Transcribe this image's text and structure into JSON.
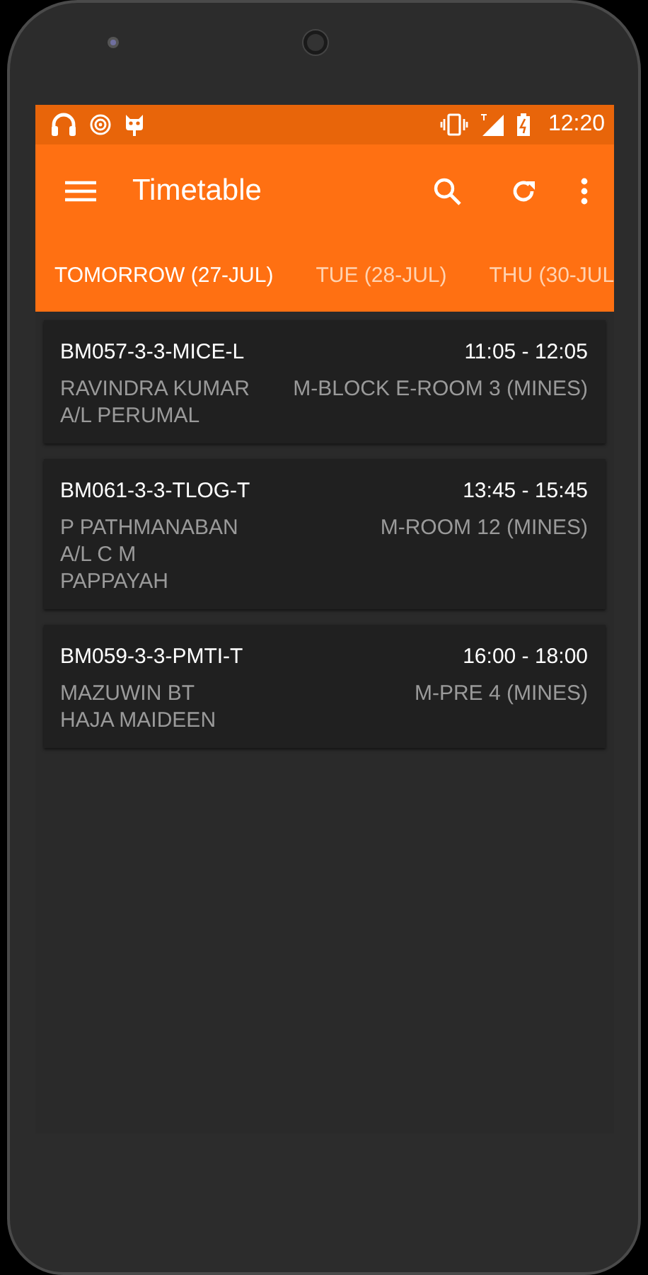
{
  "status_bar": {
    "time": "12:20"
  },
  "app_bar": {
    "title": "Timetable"
  },
  "tabs": [
    {
      "label": "TOMORROW (27-JUL)",
      "selected": true
    },
    {
      "label": "TUE (28-JUL)",
      "selected": false
    },
    {
      "label": "THU (30-JUL",
      "selected": false
    }
  ],
  "classes": [
    {
      "code": "BM057-3-3-MICE-L",
      "time": "11:05 - 12:05",
      "lecturer": "RAVINDRA  KUMAR\nA/L PERUMAL",
      "room": "M-BLOCK E-ROOM 3 (MINES)"
    },
    {
      "code": "BM061-3-3-TLOG-T",
      "time": "13:45 - 15:45",
      "lecturer": "P PATHMANABAN\nA/L C M\nPAPPAYAH",
      "room": "M-ROOM 12 (MINES)"
    },
    {
      "code": "BM059-3-3-PMTI-T",
      "time": "16:00 - 18:00",
      "lecturer": "MAZUWIN BT\nHAJA MAIDEEN",
      "room": "M-PRE 4 (MINES)"
    }
  ]
}
